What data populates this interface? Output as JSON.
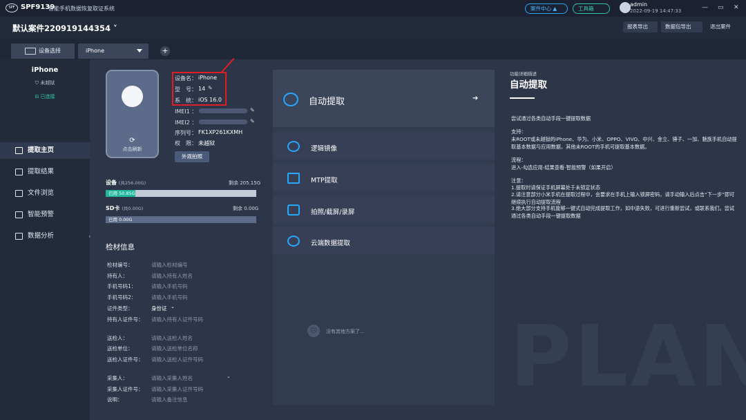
{
  "titlebar": {
    "logo": "SPF",
    "app_code": "SPF9139",
    "app_name": "智能手机数据恢复取证系统",
    "case_center": "案件中心 ▲",
    "toolbox": "工具箱",
    "user": "admin",
    "datetime": "2022-09-19 14:47:33",
    "window_buttons": [
      "—",
      "▭",
      "✕"
    ]
  },
  "casebar": {
    "case_title": "默认案件220919144354 ˅",
    "report_export": "报表导出",
    "package_export": "数据包导出",
    "exit_case": "退出案件"
  },
  "tabs": {
    "device_select": "设备选择",
    "device_dropdown": "iPhone",
    "add": "+"
  },
  "sidebar": {
    "device_name": "iPhone",
    "jailbreak_status": "未越狱",
    "connection_status": "已连接",
    "items": [
      {
        "label": "提取主页",
        "icon": "home-icon",
        "active": true
      },
      {
        "label": "提取结果",
        "icon": "result-icon",
        "active": false
      },
      {
        "label": "文件浏览",
        "icon": "folder-icon",
        "active": false
      },
      {
        "label": "智能预警",
        "icon": "warning-icon",
        "active": false
      },
      {
        "label": "数据分析",
        "icon": "analysis-icon",
        "active": false
      }
    ],
    "collapse": "‹"
  },
  "device": {
    "refresh_label": "点击刷新",
    "info": [
      {
        "label": "设备名：",
        "value": "iPhone",
        "editable": false
      },
      {
        "label": "型　号：",
        "value": "14",
        "editable": true
      },
      {
        "label": "系　统：",
        "value": "iOS 16.0",
        "editable": false
      },
      {
        "label": "IMEI1 ：",
        "value": "",
        "editable": true
      },
      {
        "label": "IMEI2 ：",
        "value": "",
        "editable": true
      },
      {
        "label": "序列号：",
        "value": "FK1XP261KXMH",
        "editable": false
      },
      {
        "label": "权　限：",
        "value": "未越狱",
        "editable": false
      }
    ],
    "photo_button": "外观拍照"
  },
  "storage": {
    "device": {
      "label": "设备",
      "total": "(共256.00G)",
      "remaining": "剩余 205.15G",
      "used": "已用 50.85G",
      "used_fraction": 0.199
    },
    "sd": {
      "label": "SD卡",
      "total": "(共0.00G)",
      "remaining": "剩余 0.00G",
      "used": "已用 0.00G",
      "used_fraction": 0
    }
  },
  "exhibit": {
    "title": "检材信息",
    "fields": [
      {
        "label": "检材编号：",
        "placeholder": "请输入检材编号"
      },
      {
        "label": "持有人：",
        "placeholder": "请输入持有人姓名"
      },
      {
        "label": "手机号码1：",
        "placeholder": "请输入手机号码"
      },
      {
        "label": "手机号码2：",
        "placeholder": "请输入手机号码"
      },
      {
        "label": "证件类型：",
        "value": "身份证"
      },
      {
        "label": "持有人证件号：",
        "placeholder": "请输入持有人证件号码"
      },
      {
        "label": "送检人：",
        "placeholder": "请输入送检人姓名"
      },
      {
        "label": "送检单位：",
        "placeholder": "请输入送检单位名称"
      },
      {
        "label": "送检人证件号：",
        "placeholder": "请输入送检人证件号码"
      },
      {
        "label": "采集人：",
        "placeholder": "请输入采集人姓名"
      },
      {
        "label": "采集人证件号：",
        "placeholder": "请输入采集人证件号码"
      },
      {
        "label": "说明：",
        "placeholder": "请输入备注信息"
      }
    ]
  },
  "extraction": {
    "auto": {
      "label": "自动提取",
      "arrow": "➔"
    },
    "options": [
      {
        "label": "逻辑镜像",
        "icon": "logic-image-icon"
      },
      {
        "label": "MTP提取",
        "icon": "mtp-icon"
      },
      {
        "label": "拍照/截屏/录屏",
        "icon": "camera-icon"
      },
      {
        "label": "云端数据提取",
        "icon": "cloud-icon"
      }
    ],
    "no_more": "没有其他方案了..."
  },
  "description": {
    "small_label": "功能详细描述",
    "title": "自动提取",
    "lines": [
      "尝试通过各类自动手段一键提取数据",
      "",
      "支持：",
      "未ROOT或未越狱的iPhone、华为、小米、OPPO、VIVO、中兴、金立、锤子、一加、魅族手机自动提取基本数据与应用数据，其他未ROOT的手机可提取基本数据。",
      "",
      "流程：",
      "进入-勾选应用-结果查看-智能预警（如果开启）",
      "",
      "注意：",
      "1.提取时请保证手机屏幕处于未锁定状态",
      "2.请注意部分小米手机在提取过程中，会要求在手机上输入锁屏密码，请手动输入后点击“下一步”即可继续执行自动提取流程",
      "3.绝大部分支持手机能够一键式自动完成提取工作，如中途失败，可进行重新尝试，或联系我们。尝试通过各类自动手段一键提取数据"
    ],
    "watermark": "PLAN"
  }
}
